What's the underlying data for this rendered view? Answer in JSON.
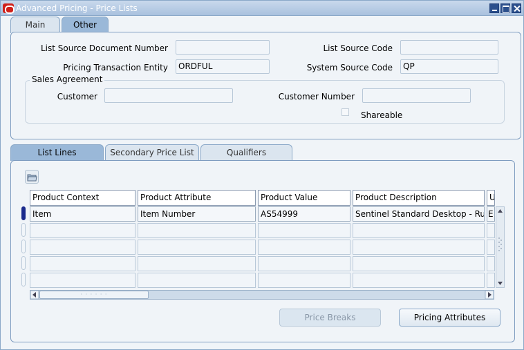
{
  "window": {
    "title": "Advanced Pricing - Price Lists"
  },
  "top_tabs": [
    {
      "label": "Main",
      "active": false
    },
    {
      "label": "Other",
      "active": true
    }
  ],
  "other_tab": {
    "list_source_document_number": {
      "label": "List Source Document Number",
      "value": ""
    },
    "list_source_code": {
      "label": "List Source Code",
      "value": ""
    },
    "pricing_transaction_entity": {
      "label": "Pricing Transaction Entity",
      "value": "ORDFUL"
    },
    "system_source_code": {
      "label": "System Source Code",
      "value": "QP"
    },
    "sales_agreement": {
      "legend": "Sales Agreement",
      "customer": {
        "label": "Customer",
        "value": ""
      },
      "customer_number": {
        "label": "Customer Number",
        "value": ""
      },
      "shareable": {
        "label": "Shareable",
        "checked": false
      }
    }
  },
  "lower_tabs": [
    {
      "label": "List Lines",
      "active": true
    },
    {
      "label": "Secondary Price List",
      "active": false
    },
    {
      "label": "Qualifiers",
      "active": false
    }
  ],
  "grid": {
    "columns": [
      "Product Context",
      "Product Attribute",
      "Product Value",
      "Product Description",
      "U"
    ],
    "rows": [
      [
        "Item",
        "Item Number",
        "AS54999",
        "Sentinel Standard Desktop - Rug",
        "E"
      ],
      [
        "",
        "",
        "",
        "",
        ""
      ],
      [
        "",
        "",
        "",
        "",
        ""
      ],
      [
        "",
        "",
        "",
        "",
        ""
      ],
      [
        "",
        "",
        "",
        "",
        ""
      ]
    ]
  },
  "buttons": {
    "price_breaks": {
      "label": "Price Breaks",
      "mnemonic": "B",
      "enabled": false
    },
    "pricing_attributes": {
      "label": "Pricing Attributes",
      "mnemonic": "P",
      "enabled": true
    }
  },
  "colors": {
    "title_bar": "#a9c1de",
    "active_tab": "#9ab8d8",
    "current_row_indicator": "#1a2a8c",
    "app_logo": "#d0201a"
  }
}
